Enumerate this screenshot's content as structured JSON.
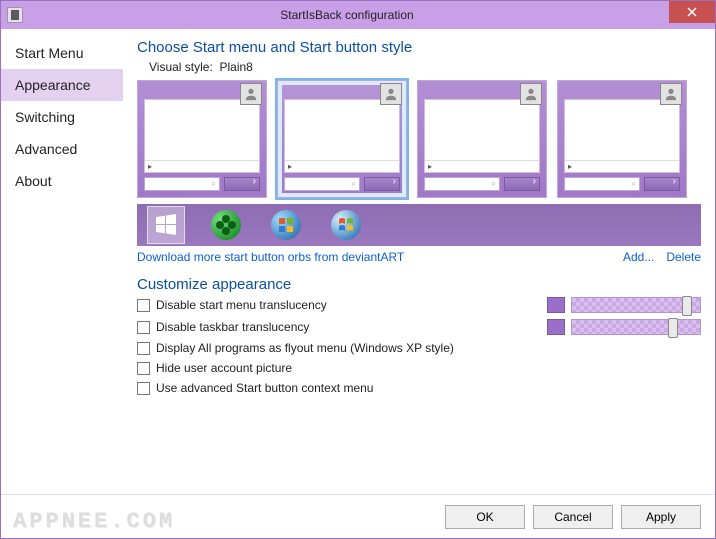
{
  "title": "StartIsBack configuration",
  "sidebar": {
    "items": [
      {
        "label": "Start Menu"
      },
      {
        "label": "Appearance"
      },
      {
        "label": "Switching"
      },
      {
        "label": "Advanced"
      },
      {
        "label": "About"
      }
    ],
    "selected": 1
  },
  "section1": {
    "heading": "Choose Start menu and Start button style",
    "visual_label": "Visual style:",
    "visual_value": "Plain8"
  },
  "links": {
    "download": "Download more start button orbs from deviantART",
    "add": "Add...",
    "delete": "Delete"
  },
  "section2": {
    "heading": "Customize appearance",
    "options": [
      {
        "label": "Disable start menu translucency",
        "checked": false,
        "slider": true
      },
      {
        "label": "Disable taskbar translucency",
        "checked": false,
        "slider": true
      },
      {
        "label": "Display All programs as flyout menu (Windows XP style)",
        "checked": false,
        "slider": false
      },
      {
        "label": "Hide user account picture",
        "checked": false,
        "slider": false
      },
      {
        "label": "Use advanced Start button context menu",
        "checked": false,
        "slider": false
      }
    ]
  },
  "buttons": {
    "ok": "OK",
    "cancel": "Cancel",
    "apply": "Apply"
  },
  "watermark": "APPNEE.COM"
}
